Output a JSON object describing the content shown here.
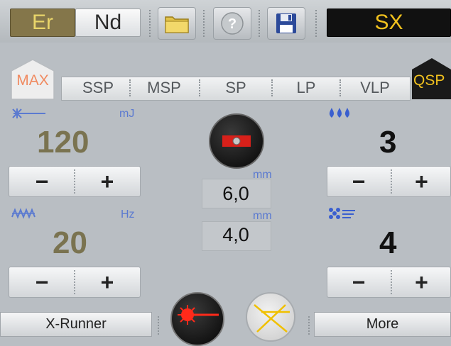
{
  "top": {
    "er_label": "Er",
    "nd_label": "Nd",
    "mode_label": "SX",
    "icons": [
      "folder-icon",
      "help-icon",
      "save-icon"
    ]
  },
  "pulse_modes": {
    "max_label": "MAX",
    "qsp_label": "QSP",
    "items": [
      "SSP",
      "MSP",
      "SP",
      "LP",
      "VLP"
    ]
  },
  "energy": {
    "value": "120",
    "unit": "mJ"
  },
  "frequency": {
    "value": "20",
    "unit": "Hz"
  },
  "water": {
    "value": "3"
  },
  "air": {
    "value": "4"
  },
  "center": {
    "spot_unit_1": "mm",
    "spot_value_1": "6,0",
    "spot_unit_2": "mm",
    "spot_value_2": "4,0"
  },
  "controls": {
    "minus": "−",
    "plus": "+"
  },
  "bottom": {
    "xrunner_label": "X-Runner",
    "more_label": "More"
  },
  "colors": {
    "accent_blue": "#5b7ad0",
    "value_olive": "#7a7350",
    "max_orange": "#f08a60"
  }
}
